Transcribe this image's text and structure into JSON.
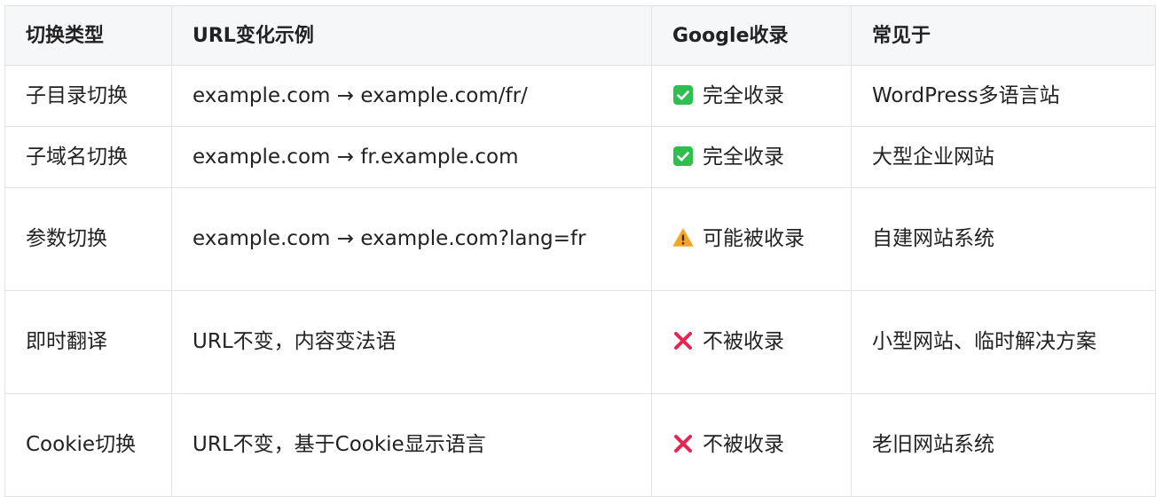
{
  "headers": [
    "切换类型",
    "URL变化示例",
    "Google收录",
    "常见于"
  ],
  "rows": [
    {
      "type": "子目录切换",
      "example": "example.com → example.com/fr/",
      "status_icon": "check-icon",
      "status": "完全收录",
      "common": "WordPress多语言站"
    },
    {
      "type": "子域名切换",
      "example": "example.com → fr.example.com",
      "status_icon": "check-icon",
      "status": "完全收录",
      "common": "大型企业网站"
    },
    {
      "type": "参数切换",
      "example": "example.com → example.com?lang=fr",
      "status_icon": "warning-icon",
      "status": "可能被收录",
      "common": "自建网站系统"
    },
    {
      "type": "即时翻译",
      "example": "URL不变，内容变法语",
      "status_icon": "cross-icon",
      "status": "不被收录",
      "common": "小型网站、临时解决方案"
    },
    {
      "type": "Cookie切换",
      "example": "URL不变，基于Cookie显示语言",
      "status_icon": "cross-icon",
      "status": "不被收录",
      "common": "老旧网站系统"
    }
  ],
  "colors": {
    "check": "#2fbf4f",
    "warning": "#f5a524",
    "cross": "#e8244f",
    "header_bg": "#f6f7f9",
    "border": "#e3e3e3"
  }
}
